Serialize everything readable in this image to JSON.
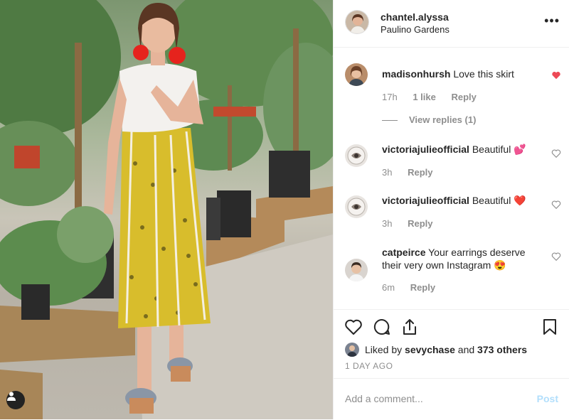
{
  "post": {
    "username": "chantel.alyssa",
    "location": "Paulino Gardens",
    "more_icon": "more-icon"
  },
  "comments": [
    {
      "username": "madisonhursh",
      "text": "Love this skirt",
      "time": "17h",
      "likes": "1 like",
      "reply": "Reply",
      "liked": true,
      "view_replies": "View replies (1)"
    },
    {
      "username": "victoriajulieofficial",
      "text": "Beautiful 💕",
      "time": "3h",
      "reply": "Reply",
      "liked": false
    },
    {
      "username": "victoriajulieofficial",
      "text": "Beautiful ❤️",
      "time": "3h",
      "reply": "Reply",
      "liked": false
    },
    {
      "username": "catpeirce",
      "text": "Your earrings deserve their very own Instagram 😍",
      "time": "6m",
      "reply": "Reply",
      "liked": false
    }
  ],
  "actions": {
    "like_icon": "heart-icon",
    "comment_icon": "comment-icon",
    "share_icon": "share-icon",
    "save_icon": "bookmark-icon"
  },
  "likes": {
    "prefix": "Liked by",
    "user": "sevychase",
    "middle": "and",
    "count": "373 others"
  },
  "date": "1 DAY AGO",
  "add_comment": {
    "placeholder": "Add a comment...",
    "post_label": "Post"
  },
  "colors": {
    "liked_heart": "#ed4956",
    "post_disabled": "#b2dffc",
    "secondary_text": "#8e8e8e"
  }
}
